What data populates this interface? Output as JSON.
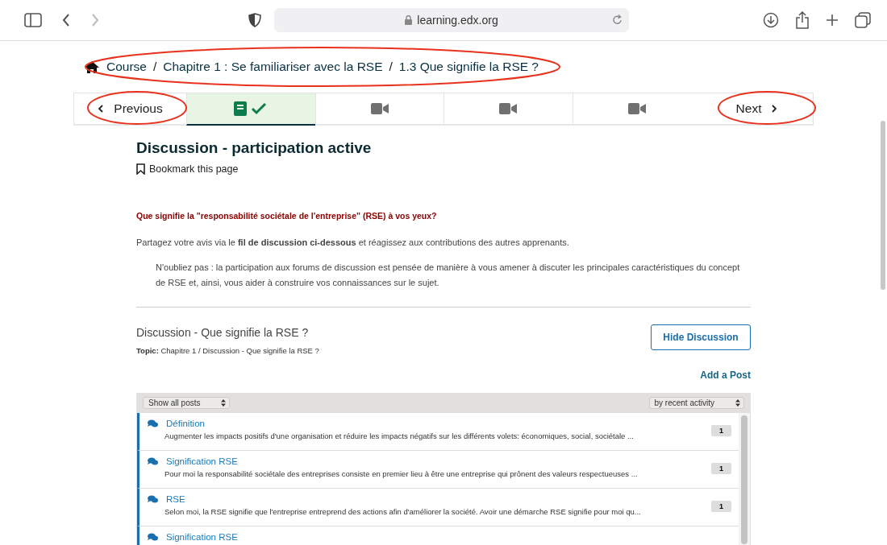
{
  "browser": {
    "address": "learning.edx.org"
  },
  "breadcrumb": [
    "Course",
    "Chapitre 1 : Se familiariser avec la RSE",
    "1.3 Que signifie la RSE ?"
  ],
  "breadcrumb_separator": "/",
  "sequence_nav": {
    "previous": "Previous",
    "next": "Next",
    "units": [
      {
        "kind": "book-check",
        "selected": true
      },
      {
        "kind": "video",
        "selected": false
      },
      {
        "kind": "video",
        "selected": false
      },
      {
        "kind": "video",
        "selected": false
      }
    ]
  },
  "unit": {
    "title": "Discussion - participation active",
    "bookmark": "Bookmark this page",
    "question": "Que signifie la \"responsabilité sociétale de l'entreprise\" (RSE) à vos yeux?",
    "instruction": "Partagez votre avis via le **fil de discussion ci-dessous** et réagissez aux contributions des autres apprenants.",
    "note": "N'oubliez pas : la participation aux forums de discussion est pensée de manière à vous amener à discuter les principales caractéristiques du concept de RSE et, ainsi, vous aider à construire vos connaissances sur le sujet."
  },
  "discussion": {
    "title": "Discussion - Que signifie la RSE ?",
    "topic_label": "Topic:",
    "topic": "Chapitre 1 / Discussion - Que signifie la RSE ?",
    "hide_button": "Hide Discussion",
    "add_post": "Add a Post",
    "filter": "Show all posts",
    "sort": "by recent activity",
    "posts": [
      {
        "title": "Définition",
        "excerpt": "Augmenter les impacts positifs d'une organisation et réduire les impacts négatifs sur les différents volets: économiques, social, sociétale ...",
        "count": "1"
      },
      {
        "title": "Signification RSE",
        "excerpt": "Pour moi la responsabilité sociétale des entreprises consiste en premier lieu à être une entreprise qui prônent des valeurs respectueuses ...",
        "count": "1"
      },
      {
        "title": "RSE",
        "excerpt": "Selon moi, la RSE signifie que l'entreprise entreprend des actions afin d'améliorer la société. Avoir une démarche RSE signifie pour moi qu...",
        "count": "1"
      },
      {
        "title": "Signification RSE"
      }
    ]
  }
}
